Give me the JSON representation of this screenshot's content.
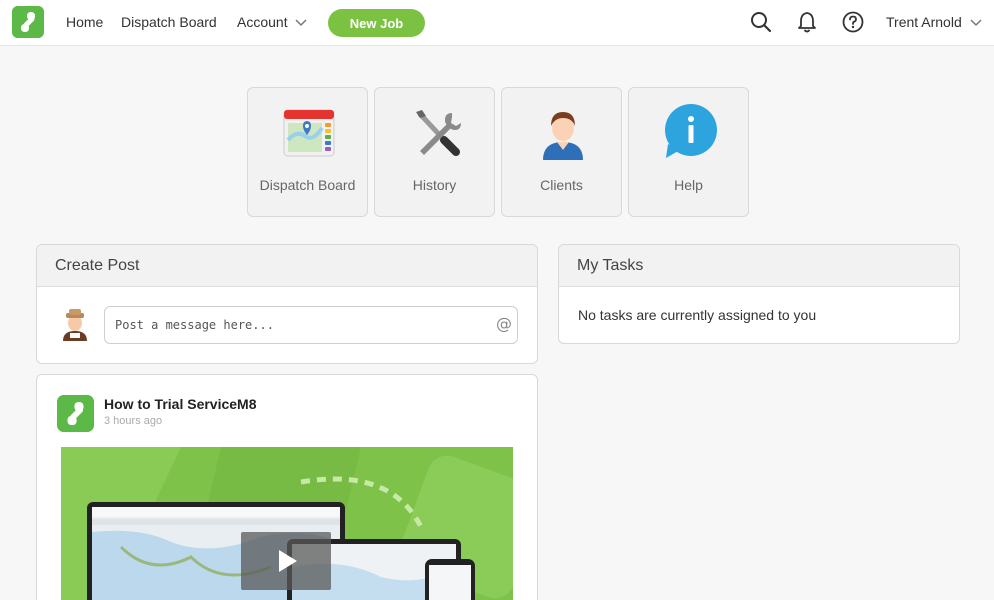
{
  "nav": {
    "home": "Home",
    "dispatch_board": "Dispatch Board",
    "account": "Account",
    "new_job": "New Job",
    "user_name": "Trent Arnold"
  },
  "tiles": [
    {
      "label": "Dispatch Board",
      "icon": "calendar-map-icon"
    },
    {
      "label": "History",
      "icon": "tools-icon"
    },
    {
      "label": "Clients",
      "icon": "person-icon"
    },
    {
      "label": "Help",
      "icon": "info-bubble-icon"
    }
  ],
  "create_post": {
    "title": "Create Post",
    "placeholder": "Post a message here...",
    "mention_symbol": "@"
  },
  "my_tasks": {
    "title": "My Tasks",
    "empty_message": "No tasks are currently assigned to you"
  },
  "feed": {
    "title": "How to Trial ServiceM8",
    "time": "3 hours ago"
  },
  "colors": {
    "brand_green": "#5cb947",
    "button_green": "#7cc242"
  }
}
